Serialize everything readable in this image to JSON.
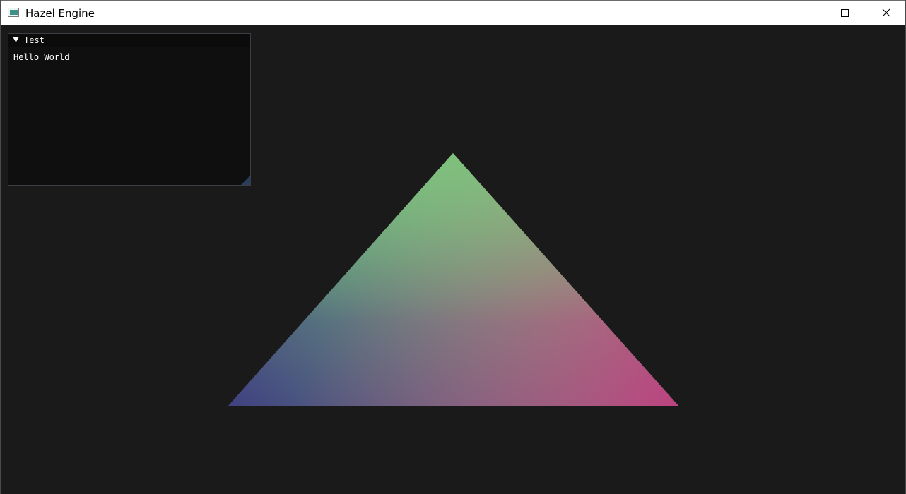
{
  "window": {
    "title": "Hazel Engine",
    "icon": "application-window-icon",
    "controls": {
      "minimize_icon": "minimize-icon",
      "maximize_icon": "maximize-icon",
      "close_icon": "close-icon"
    }
  },
  "imgui": {
    "window_title": "Test",
    "collapse_icon": "collapse-arrow-icon",
    "text": "Hello World"
  },
  "scene": {
    "background_color": "#1a1a1a",
    "triangle": {
      "top_color": "#7dc47d",
      "bottom_left_color": "#404080",
      "bottom_right_color": "#c03c80"
    }
  }
}
